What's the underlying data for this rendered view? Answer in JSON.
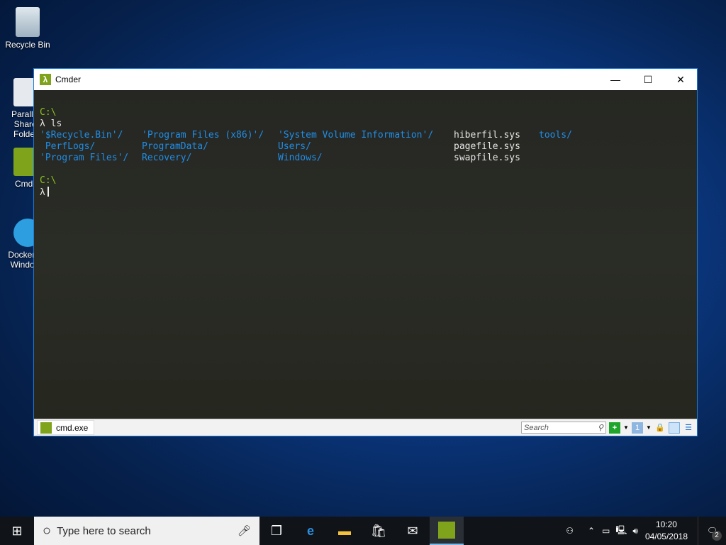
{
  "desktop": {
    "icons": [
      {
        "label": "Recycle Bin"
      },
      {
        "label": "Parallels Shared Folders"
      },
      {
        "label": "Cmder"
      },
      {
        "label": "Docker for Windows"
      }
    ]
  },
  "window": {
    "title": "Cmder",
    "minimize": "—",
    "maximize": "☐",
    "close": "✕"
  },
  "terminal": {
    "prompt1": "C:\\",
    "cmd1": "λ ls",
    "listing": [
      [
        "'$Recycle.Bin'/",
        "'Program Files (x86)'/",
        "'System Volume Information'/",
        "hiberfil.sys",
        "tools/"
      ],
      [
        " PerfLogs/",
        "ProgramData/",
        "Users/",
        "pagefile.sys",
        ""
      ],
      [
        "'Program Files'/",
        "Recovery/",
        "Windows/",
        "swapfile.sys",
        ""
      ]
    ],
    "prompt2": "C:\\",
    "lambda": "λ"
  },
  "statusbar": {
    "tab": "cmd.exe",
    "search_placeholder": "Search"
  },
  "taskbar": {
    "search_placeholder": "Type here to search",
    "time": "10:20",
    "date": "04/05/2018",
    "notifications": "2"
  }
}
